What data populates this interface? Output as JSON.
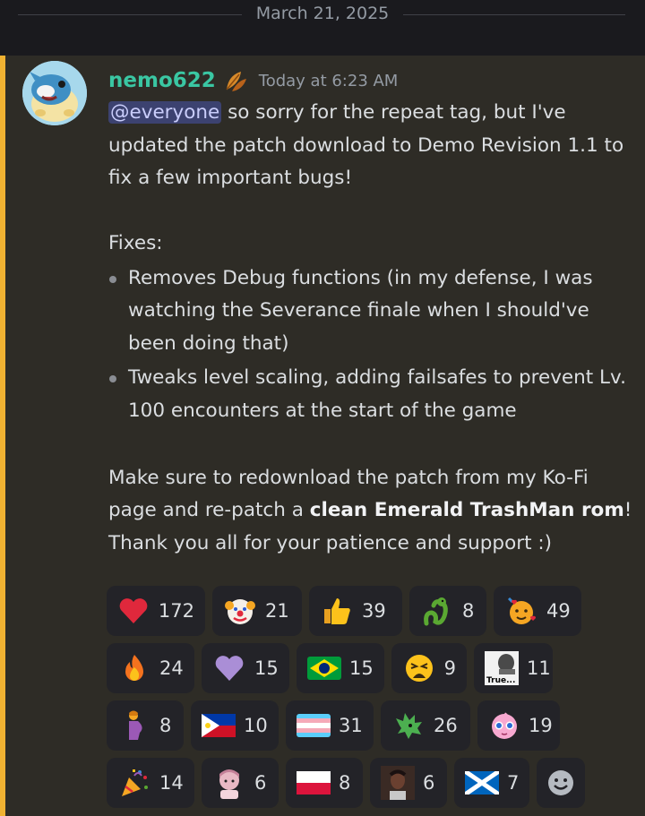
{
  "date_divider": "March 21, 2025",
  "message": {
    "username": "nemo622",
    "timestamp": "Today at 6:23 AM",
    "mention": "@everyone",
    "intro": " so sorry for the repeat tag, but I've updated the patch download to Demo Revision 1.1 to fix a few important bugs!",
    "fixes_heading": "Fixes:",
    "fixes": [
      "Removes Debug functions (in my defense, I was watching the Severance finale when I should've been doing that)",
      "Tweaks level scaling, adding failsafes to prevent Lv. 100 encounters at the start of the game"
    ],
    "outro_pre": "Make sure to redownload the patch from my Ko-Fi page and re-patch a ",
    "outro_bold": "clean Emerald TrashMan rom",
    "outro_post": "! Thank you all for your patience and support :)"
  },
  "reactions": [
    {
      "icon": "red-heart",
      "count": "172"
    },
    {
      "icon": "clown-face",
      "count": "21"
    },
    {
      "icon": "thumbs-up",
      "count": "39"
    },
    {
      "icon": "snake",
      "count": "8"
    },
    {
      "icon": "face-with-hearts",
      "count": "49"
    },
    {
      "icon": "fire",
      "count": "24"
    },
    {
      "icon": "purple-heart",
      "count": "15"
    },
    {
      "icon": "brazil-flag",
      "count": "15"
    },
    {
      "icon": "weary-face",
      "count": "9"
    },
    {
      "icon": "true-meme",
      "count": "11",
      "label": "True..."
    },
    {
      "icon": "pregnant-person",
      "count": "8"
    },
    {
      "icon": "philippines-flag",
      "count": "10"
    },
    {
      "icon": "transgender-flag",
      "count": "31"
    },
    {
      "icon": "green-pokemon",
      "count": "26"
    },
    {
      "icon": "jigglypuff",
      "count": "19"
    },
    {
      "icon": "party-popper",
      "count": "14"
    },
    {
      "icon": "pink-character",
      "count": "6"
    },
    {
      "icon": "poland-flag",
      "count": "8"
    },
    {
      "icon": "person-photo",
      "count": "6"
    },
    {
      "icon": "scotland-flag",
      "count": "7"
    }
  ]
}
